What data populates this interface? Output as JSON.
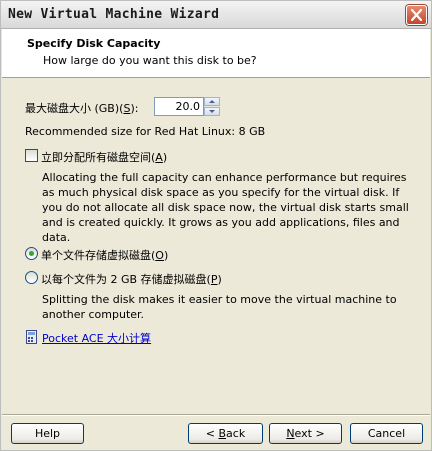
{
  "window": {
    "title": "New Virtual Machine Wizard",
    "close_icon": "close-icon"
  },
  "header": {
    "title": "Specify Disk Capacity",
    "subtitle": "How large do you want this disk to be?"
  },
  "disk_size": {
    "label_prefix": "最大磁盘大小 (GB)(",
    "label_key": "S",
    "label_suffix": "):",
    "value": "20.0",
    "recommended": "Recommended size for Red Hat Linux: 8 GB"
  },
  "allocate_now": {
    "label_prefix": "立即分配所有磁盘空间(",
    "label_key": "A",
    "label_suffix": ")",
    "checked": false,
    "description": "Allocating the full capacity can enhance performance but requires as much physical disk space as you specify for the virtual disk. If you do not allocate all disk space now, the virtual disk starts small and is created quickly. It grows as you add applications, files and data."
  },
  "single_file": {
    "label_prefix": "单个文件存储虚拟磁盘(",
    "label_key": "O",
    "label_suffix": ")",
    "selected": true
  },
  "split_files": {
    "label_prefix": "以每个文件为 2 GB 存储虚拟磁盘(",
    "label_key": "P",
    "label_suffix": ")",
    "selected": false,
    "description": "Splitting the disk makes it easier to move the virtual machine to another computer."
  },
  "pocket_ace": {
    "link": "Pocket ACE 大小计算",
    "icon": "calculator-icon"
  },
  "buttons": {
    "help": "Help",
    "back_prefix": "< ",
    "back_key": "B",
    "back_suffix": "ack",
    "next_key": "N",
    "next_suffix": "ext >",
    "cancel": "Cancel"
  },
  "colors": {
    "link": "#0000cc",
    "radio_selected": "#2fa82f",
    "close_button": "#c2462a"
  }
}
